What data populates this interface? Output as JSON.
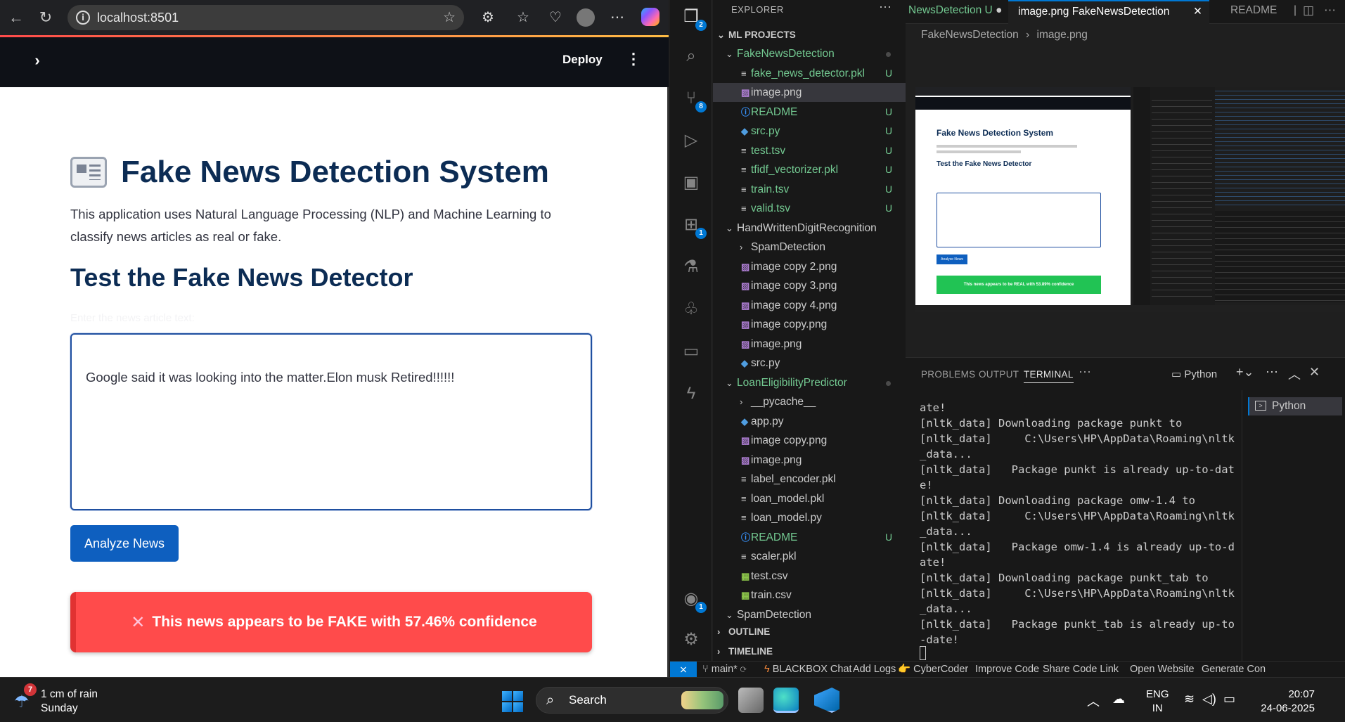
{
  "browser": {
    "url": "localhost:8501",
    "deploy_label": "Deploy"
  },
  "app": {
    "title": "Fake News Detection System",
    "description": "This application uses Natural Language Processing (NLP) and Machine Learning to classify news articles as real or fake.",
    "subtitle": "Test the Fake News Detector",
    "textarea_label": "Enter the news article text:",
    "textarea_value": "Google said it was looking into the matter.Elon musk Retired!!!!!!",
    "analyze_button": "Analyze News",
    "result_icon": "✕",
    "result_text": "This news appears to be FAKE with 57.46% confidence",
    "result_color": "#ff4b4b"
  },
  "vscode": {
    "explorer_title": "EXPLORER",
    "workspace": "ML PROJECTS",
    "tree": [
      {
        "name": "FakeNewsDetection",
        "kind": "folder-open",
        "depth": 1,
        "color": "#73c991",
        "dot": true
      },
      {
        "name": "fake_news_detector.pkl",
        "kind": "file",
        "depth": 2,
        "color": "#73c991",
        "status": "U"
      },
      {
        "name": "image.png",
        "kind": "image",
        "depth": 2,
        "color": "#cccccc",
        "selected": true
      },
      {
        "name": "README",
        "kind": "info",
        "depth": 2,
        "color": "#73c991",
        "status": "U"
      },
      {
        "name": "src.py",
        "kind": "python",
        "depth": 2,
        "color": "#73c991",
        "status": "U"
      },
      {
        "name": "test.tsv",
        "kind": "file",
        "depth": 2,
        "color": "#73c991",
        "status": "U"
      },
      {
        "name": "tfidf_vectorizer.pkl",
        "kind": "file",
        "depth": 2,
        "color": "#73c991",
        "status": "U"
      },
      {
        "name": "train.tsv",
        "kind": "file",
        "depth": 2,
        "color": "#73c991",
        "status": "U"
      },
      {
        "name": "valid.tsv",
        "kind": "file",
        "depth": 2,
        "color": "#73c991",
        "status": "U"
      },
      {
        "name": "HandWrittenDigitRecognition",
        "kind": "folder-open",
        "depth": 1,
        "color": "#cccccc"
      },
      {
        "name": "SpamDetection",
        "kind": "folder-closed",
        "depth": 2,
        "color": "#cccccc"
      },
      {
        "name": "image copy 2.png",
        "kind": "image",
        "depth": 2,
        "color": "#cccccc"
      },
      {
        "name": "image copy 3.png",
        "kind": "image",
        "depth": 2,
        "color": "#cccccc"
      },
      {
        "name": "image copy 4.png",
        "kind": "image",
        "depth": 2,
        "color": "#cccccc"
      },
      {
        "name": "image copy.png",
        "kind": "image",
        "depth": 2,
        "color": "#cccccc"
      },
      {
        "name": "image.png",
        "kind": "image",
        "depth": 2,
        "color": "#cccccc"
      },
      {
        "name": "src.py",
        "kind": "python",
        "depth": 2,
        "color": "#cccccc"
      },
      {
        "name": "LoanEligibilityPredictor",
        "kind": "folder-open",
        "depth": 1,
        "color": "#73c991",
        "dot": true
      },
      {
        "name": "__pycache__",
        "kind": "folder-closed",
        "depth": 2,
        "color": "#cccccc"
      },
      {
        "name": "app.py",
        "kind": "python",
        "depth": 2,
        "color": "#cccccc"
      },
      {
        "name": "image copy.png",
        "kind": "image",
        "depth": 2,
        "color": "#cccccc"
      },
      {
        "name": "image.png",
        "kind": "image",
        "depth": 2,
        "color": "#cccccc"
      },
      {
        "name": "label_encoder.pkl",
        "kind": "file",
        "depth": 2,
        "color": "#cccccc"
      },
      {
        "name": "loan_model.pkl",
        "kind": "file",
        "depth": 2,
        "color": "#cccccc"
      },
      {
        "name": "loan_model.py",
        "kind": "file",
        "depth": 2,
        "color": "#cccccc"
      },
      {
        "name": "README",
        "kind": "info",
        "depth": 2,
        "color": "#73c991",
        "status": "U"
      },
      {
        "name": "scaler.pkl",
        "kind": "file",
        "depth": 2,
        "color": "#cccccc"
      },
      {
        "name": "test.csv",
        "kind": "table",
        "depth": 2,
        "color": "#cccccc"
      },
      {
        "name": "train.csv",
        "kind": "table",
        "depth": 2,
        "color": "#cccccc"
      },
      {
        "name": "SpamDetection",
        "kind": "folder-open",
        "depth": 1,
        "color": "#cccccc"
      }
    ],
    "outline_label": "OUTLINE",
    "timeline_label": "TIMELINE",
    "tabs": [
      {
        "label": "NewsDetection  U",
        "active": false
      },
      {
        "label": "image.png  FakeNewsDetection",
        "active": true
      },
      {
        "label": "README",
        "active": false
      }
    ],
    "breadcrumb": [
      "FakeNewsDetection",
      "image.png"
    ],
    "panel_tabs": [
      "PROBLEMS",
      "OUTPUT",
      "TERMINAL"
    ],
    "terminal_profile": "Python",
    "terminal_lines": [
      "ate!",
      "[nltk_data] Downloading package punkt to",
      "[nltk_data]     C:\\Users\\HP\\AppData\\Roaming\\nltk",
      "_data...",
      "[nltk_data]   Package punkt is already up-to-dat",
      "e!",
      "[nltk_data] Downloading package omw-1.4 to",
      "[nltk_data]     C:\\Users\\HP\\AppData\\Roaming\\nltk",
      "_data...",
      "[nltk_data]   Package omw-1.4 is already up-to-d",
      "ate!",
      "[nltk_data] Downloading package punkt_tab to",
      "[nltk_data]     C:\\Users\\HP\\AppData\\Roaming\\nltk",
      "_data...",
      "[nltk_data]   Package punkt_tab is already up-to",
      "-date!"
    ],
    "terminal_list_item": "Python",
    "status_bar": {
      "branch": "main*",
      "items": [
        "BLACKBOX Chat",
        "Add Logs",
        "CyberCoder",
        "Improve Code",
        "Share Code Link",
        "Open Website",
        "Generate Con"
      ]
    },
    "activity_badges": {
      "explorer": "2",
      "scm": "8",
      "extensions": "1",
      "accounts": "1"
    }
  },
  "preview": {
    "mini_title": "Fake News Detection System",
    "mini_subtitle": "Test the Fake News Detector",
    "mini_button": "Analyze News",
    "mini_result": "This news appears to be REAL with 53.89% confidence"
  },
  "taskbar": {
    "weather_line1": "1 cm of rain",
    "weather_line2": "Sunday",
    "weather_badge": "7",
    "search_label": "Search",
    "lang_line1": "ENG",
    "lang_line2": "IN",
    "time": "20:07",
    "date": "24-06-2025"
  }
}
